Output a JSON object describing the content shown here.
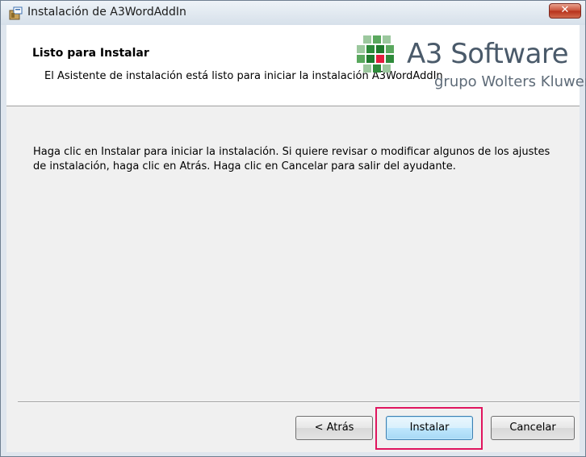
{
  "window": {
    "title": "Instalación de A3WordAddIn",
    "close_label": "✕"
  },
  "header": {
    "title": "Listo para Instalar",
    "description": "El Asistente de instalación está listo para iniciar la instalación A3WordAddIn",
    "logo": {
      "name": "A3 Software",
      "subtitle": "grupo Wolters Kluwer",
      "icon": "a3-logo-icon"
    }
  },
  "main": {
    "text": "Haga clic en Instalar para iniciar la instalación. Si quiere revisar o modificar algunos de los ajustes de instalación, haga clic en Atrás. Haga clic en Cancelar para salir del ayudante."
  },
  "buttons": {
    "back": "< Atrás",
    "install": "Instalar",
    "cancel": "Cancelar"
  },
  "colors": {
    "highlight": "#e0155e",
    "logo_green": "#2e8b3a",
    "logo_red": "#e31c3d"
  }
}
